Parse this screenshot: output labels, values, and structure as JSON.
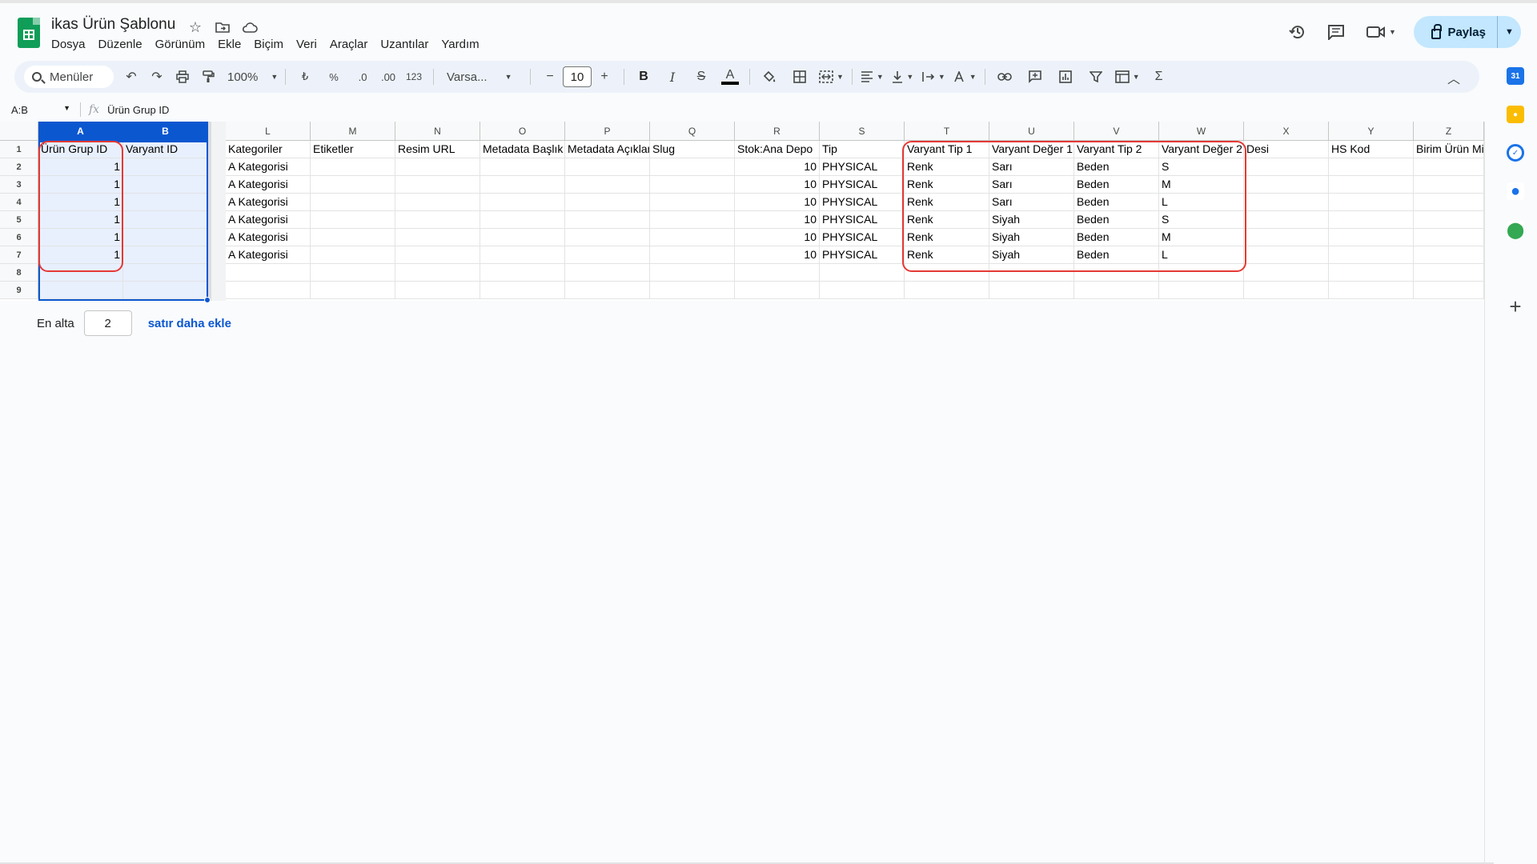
{
  "app": {
    "title": "ikas Ürün Şablonu",
    "menu": [
      "Dosya",
      "Düzenle",
      "Görünüm",
      "Ekle",
      "Biçim",
      "Veri",
      "Araçlar",
      "Uzantılar",
      "Yardım"
    ],
    "share_label": "Paylaş"
  },
  "toolbar": {
    "search_label": "Menüler",
    "zoom": "100%",
    "currency": "₺",
    "percent": "%",
    "decrease_decimals": ".0",
    "increase_decimals": ".00",
    "number_format": "123",
    "font": "Varsa...",
    "font_size": "10",
    "bold": "B",
    "italic": "I",
    "strike": "S",
    "text_color": "A",
    "sum": "Σ"
  },
  "formula_bar": {
    "name_box": "A:B",
    "fx": "fx",
    "value": "Ürün Grup ID"
  },
  "grid": {
    "columns": [
      "A",
      "B",
      "L",
      "M",
      "N",
      "O",
      "P",
      "Q",
      "R",
      "S",
      "T",
      "U",
      "V",
      "W",
      "X",
      "Y",
      "Z"
    ],
    "row_numbers": [
      "1",
      "2",
      "3",
      "4",
      "5",
      "6",
      "7",
      "8",
      "9"
    ],
    "header_row": [
      "Ürün Grup ID",
      "Varyant ID",
      "Kategoriler",
      "Etiketler",
      "Resim URL",
      "Metadata Başlık",
      "Metadata Açıklama",
      "Slug",
      "Stok:Ana Depo",
      "Tip",
      "Varyant Tip 1",
      "Varyant Değer 1",
      "Varyant Tip 2",
      "Varyant Değer 2",
      "Desi",
      "HS Kod",
      "Birim Ürün Mi"
    ],
    "data_rows": [
      [
        "1",
        "",
        "A Kategorisi",
        "",
        "",
        "",
        "",
        "",
        "10",
        "PHYSICAL",
        "Renk",
        "Sarı",
        "Beden",
        "S",
        "",
        "",
        ""
      ],
      [
        "1",
        "",
        "A Kategorisi",
        "",
        "",
        "",
        "",
        "",
        "10",
        "PHYSICAL",
        "Renk",
        "Sarı",
        "Beden",
        "M",
        "",
        "",
        ""
      ],
      [
        "1",
        "",
        "A Kategorisi",
        "",
        "",
        "",
        "",
        "",
        "10",
        "PHYSICAL",
        "Renk",
        "Sarı",
        "Beden",
        "L",
        "",
        "",
        ""
      ],
      [
        "1",
        "",
        "A Kategorisi",
        "",
        "",
        "",
        "",
        "",
        "10",
        "PHYSICAL",
        "Renk",
        "Siyah",
        "Beden",
        "S",
        "",
        "",
        ""
      ],
      [
        "1",
        "",
        "A Kategorisi",
        "",
        "",
        "",
        "",
        "",
        "10",
        "PHYSICAL",
        "Renk",
        "Siyah",
        "Beden",
        "M",
        "",
        "",
        ""
      ],
      [
        "1",
        "",
        "A Kategorisi",
        "",
        "",
        "",
        "",
        "",
        "10",
        "PHYSICAL",
        "Renk",
        "Siyah",
        "Beden",
        "L",
        "",
        "",
        ""
      ],
      [
        "",
        "",
        "",
        "",
        "",
        "",
        "",
        "",
        "",
        "",
        "",
        "",
        "",
        "",
        "",
        "",
        ""
      ],
      [
        "",
        "",
        "",
        "",
        "",
        "",
        "",
        "",
        "",
        "",
        "",
        "",
        "",
        "",
        "",
        "",
        ""
      ]
    ],
    "numeric_columns": [
      "A",
      "R"
    ],
    "selected_columns": [
      "A",
      "B"
    ]
  },
  "add_rows": {
    "prefix": "En alta",
    "count": "2",
    "link": "satır daha ekle"
  },
  "colors": {
    "accent": "#0b57d0",
    "highlight_box": "#e53935",
    "share_bg": "#c2e7ff",
    "sheets_green": "#0f9d58"
  },
  "side_panel": [
    "calendar-icon",
    "keep-icon",
    "tasks-icon",
    "contacts-icon",
    "maps-icon",
    "add-icon"
  ]
}
